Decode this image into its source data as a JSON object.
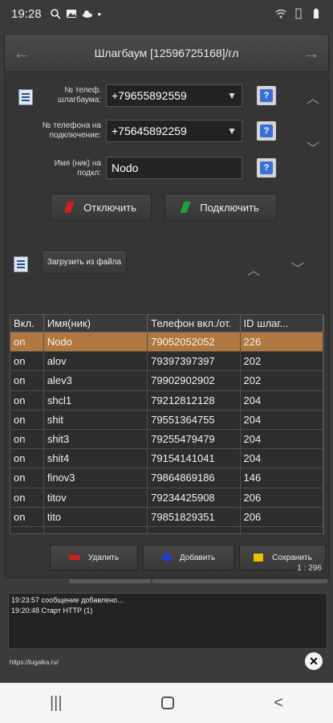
{
  "status": {
    "time": "19:28",
    "icons_left": [
      "search-icon",
      "image-icon",
      "cloud-icon",
      "dot-icon"
    ],
    "icons_right": [
      "wifi-icon",
      "vibrate-icon",
      "battery-icon"
    ]
  },
  "titlebar": {
    "title": "Шлагбаум [12596725168]/гл",
    "back": "←",
    "forward": "→"
  },
  "form": {
    "phone_label": "№ телеф. шлагбаума:",
    "phone_value": "+79655892559",
    "connect_label": "№ телефона на подключение:",
    "connect_value": "+75645892259",
    "nick_label": "Имя (ник) на подкл:",
    "nick_value": "Nodo",
    "help": "?"
  },
  "actions": {
    "disconnect": "Отключить",
    "connect": "Подключить",
    "load_file": "Загрузить из файла"
  },
  "table": {
    "headers": [
      "Вкл.",
      "Имя(ник)",
      "Телефон вкл./от.",
      "ID шлаг..."
    ],
    "rows": [
      [
        "on",
        "Nodo",
        "79052052052",
        "226"
      ],
      [
        "on",
        "alov",
        "79397397397",
        "202"
      ],
      [
        "on",
        "alev3",
        "79902902902",
        "202"
      ],
      [
        "on",
        "shcl1",
        "79212812128",
        "204"
      ],
      [
        "on",
        "shit",
        "79551364755",
        "204"
      ],
      [
        "on",
        "shit3",
        "79255479479",
        "204"
      ],
      [
        "on",
        "shit4",
        "79154141041",
        "204"
      ],
      [
        "on",
        "finov3",
        "79864869186",
        "146"
      ],
      [
        "on",
        "titov",
        "79234425908",
        "206"
      ],
      [
        "on",
        "tito",
        "79851829351",
        "206"
      ]
    ],
    "selected_row": 0
  },
  "buttons": {
    "delete": "Удалить",
    "add": "Добавить",
    "save": "Сохранить"
  },
  "counter": "1 : 296",
  "log": [
    "19:23:57 сообщение добавлено...",
    "19:20:48 Старт HTTP (1)"
  ],
  "footer": {
    "link": "https://lugalka.ru/",
    "close": "✕"
  },
  "navbar": {
    "recent": "|||",
    "back": "<"
  }
}
